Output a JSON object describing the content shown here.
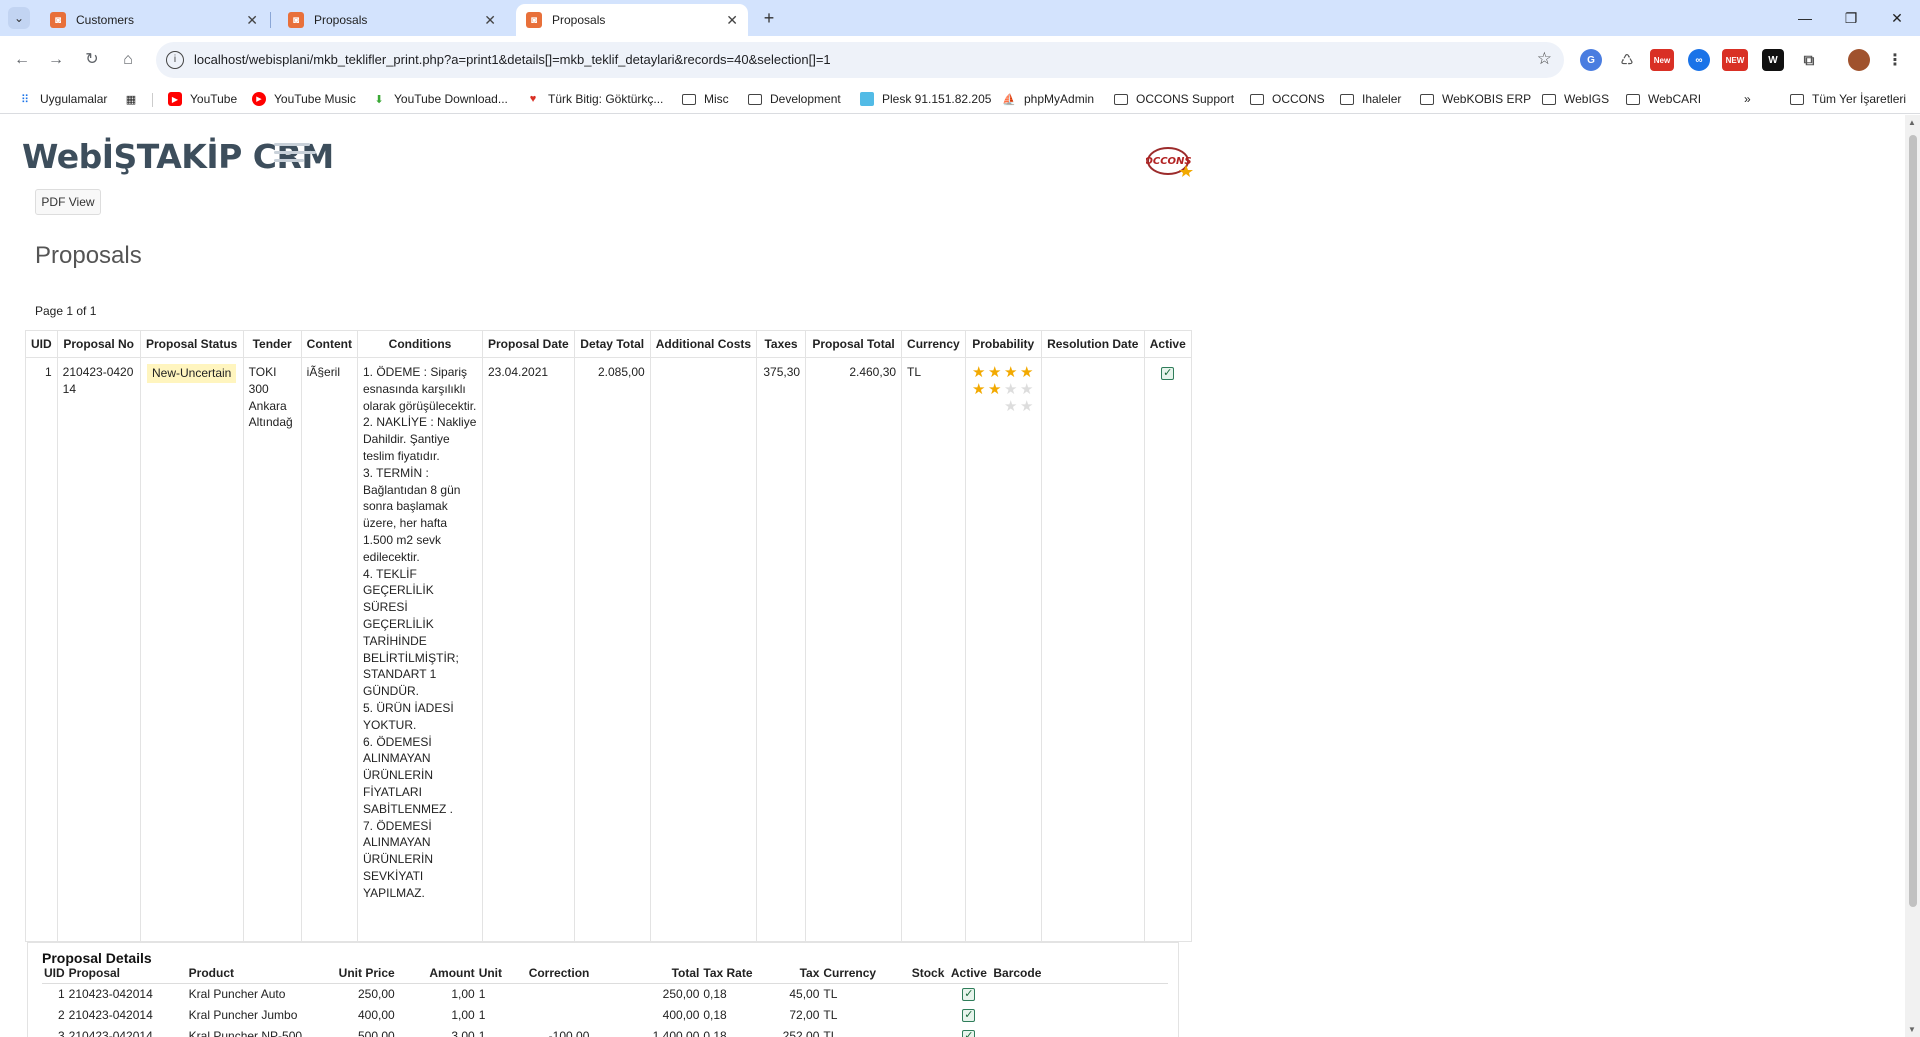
{
  "browser": {
    "tabs": [
      {
        "title": "Customers",
        "active": false
      },
      {
        "title": "Proposals",
        "active": false
      },
      {
        "title": "Proposals",
        "active": true
      }
    ],
    "url": "localhost/webisplani/mkb_teklifler_print.php?a=print1&details[]=mkb_teklif_detaylari&records=40&selection[]=1",
    "extensions": [
      {
        "name": "translate-icon",
        "color": "#4a7de0"
      },
      {
        "name": "recycle-icon",
        "color": "#555555"
      },
      {
        "name": "new-badge-icon",
        "label": "New",
        "color": "#d93025"
      },
      {
        "name": "infinity-icon",
        "color": "#1a73e8"
      },
      {
        "name": "new-gift-icon",
        "label": "NEW",
        "color": "#d93025"
      },
      {
        "name": "w-icon",
        "label": "W",
        "color": "#111111"
      },
      {
        "name": "puzzle-icon",
        "color": "#555555"
      }
    ],
    "bookmarks": [
      {
        "label": "Uygulamalar",
        "icon": "apps-grid-icon"
      },
      {
        "label": "",
        "icon": "tab-groups-icon"
      },
      {
        "label": "YouTube",
        "icon": "youtube-icon"
      },
      {
        "label": "YouTube Music",
        "icon": "youtube-music-icon"
      },
      {
        "label": "YouTube Download...",
        "icon": "download-icon"
      },
      {
        "label": "Türk Bitig: Göktürkç...",
        "icon": "heart-icon"
      },
      {
        "label": "Misc",
        "icon": "folder-icon"
      },
      {
        "label": "Development",
        "icon": "folder-icon"
      },
      {
        "label": "Plesk 91.151.82.205",
        "icon": "plesk-icon"
      },
      {
        "label": "phpMyAdmin",
        "icon": "phpmyadmin-icon"
      },
      {
        "label": "OCCONS Support",
        "icon": "folder-icon"
      },
      {
        "label": "OCCONS",
        "icon": "folder-icon"
      },
      {
        "label": "Ihaleler",
        "icon": "folder-icon"
      },
      {
        "label": "WebKOBIS ERP",
        "icon": "folder-icon"
      },
      {
        "label": "WebIGS",
        "icon": "folder-icon"
      },
      {
        "label": "WebCARI",
        "icon": "folder-icon"
      }
    ],
    "bookmarks_overflow": "»",
    "all_bookmarks": "Tüm Yer İşaretleri"
  },
  "page": {
    "logo_text": "WebİŞTAKİP CRM",
    "pdf_button": "PDF View",
    "heading": "Proposals",
    "page_info": "Page 1 of 1"
  },
  "proposals_table": {
    "headers": [
      "UID",
      "Proposal No",
      "Proposal Status",
      "Tender",
      "Content",
      "Conditions",
      "Proposal Date",
      "Detay Total",
      "Additional Costs",
      "Taxes",
      "Proposal Total",
      "Currency",
      "Probability",
      "Resolution Date",
      "Active"
    ],
    "rows": [
      {
        "uid": "1",
        "proposal_no": "210423-042014",
        "status": "New-Uncertain",
        "tender": "TOKI 300 Ankara Altındağ",
        "content": "iÃ§eril",
        "conditions": "1. ÖDEME : Sipariş esnasında karşılıklı olarak görüşülecektir.\n2. NAKLİYE : Nakliye Dahildir. Şantiye teslim fiyatıdır.\n3. TERMİN : Bağlantıdan 8 gün sonra başlamak üzere, her hafta 1.500 m2 sevk edilecektir.\n4. TEKLİF GEÇERLİLİK SÜRESİ GEÇERLİLİK TARİHİNDE BELİRTİLMİŞTİR; STANDART 1 GÜNDÜR.\n5. ÜRÜN İADESİ YOKTUR.\n6. ÖDEMESİ ALINMAYAN ÜRÜNLERİN FİYATLARI SABİTLENMEZ .\n7. ÖDEMESİ ALINMAYAN ÜRÜNLERİN SEVKİYATI YAPILMAZ.",
        "proposal_date": "23.04.2021",
        "detay_total": "2.085,00",
        "additional_costs": "",
        "taxes": "375,30",
        "proposal_total": "2.460,30",
        "currency": "TL",
        "probability": 6,
        "probability_max": 10,
        "resolution_date": "",
        "active": true
      }
    ]
  },
  "details": {
    "title": "Proposal Details",
    "headers": [
      "UID",
      "Proposal",
      "Product",
      "Unit Price",
      "Amount",
      "Unit",
      "Correction",
      "Total",
      "Tax Rate",
      "Tax",
      "Currency",
      "Stock",
      "Active",
      "Barcode"
    ],
    "rows": [
      {
        "uid": "1",
        "proposal": "210423-042014",
        "product": "Kral Puncher Auto",
        "unit_price": "250,00",
        "amount": "1,00",
        "unit": "1",
        "correction": "",
        "total": "250,00",
        "tax_rate": "0,18",
        "tax": "45,00",
        "currency": "TL",
        "stock": "",
        "active": true,
        "barcode": ""
      },
      {
        "uid": "2",
        "proposal": "210423-042014",
        "product": "Kral Puncher Jumbo",
        "unit_price": "400,00",
        "amount": "1,00",
        "unit": "1",
        "correction": "",
        "total": "400,00",
        "tax_rate": "0,18",
        "tax": "72,00",
        "currency": "TL",
        "stock": "",
        "active": true,
        "barcode": ""
      },
      {
        "uid": "3",
        "proposal": "210423-042014",
        "product": "Kral Puncher NP-500",
        "unit_price": "500,00",
        "amount": "3,00",
        "unit": "1",
        "correction": "-100,00",
        "total": "1.400,00",
        "tax_rate": "0,18",
        "tax": "252,00",
        "currency": "TL",
        "stock": "",
        "active": true,
        "barcode": ""
      }
    ]
  },
  "colors": {
    "tabstrip": "#d3e3fd",
    "status_badge": "#fff5bf",
    "star_on": "#f2a900",
    "logo": "#3d4e5c"
  }
}
